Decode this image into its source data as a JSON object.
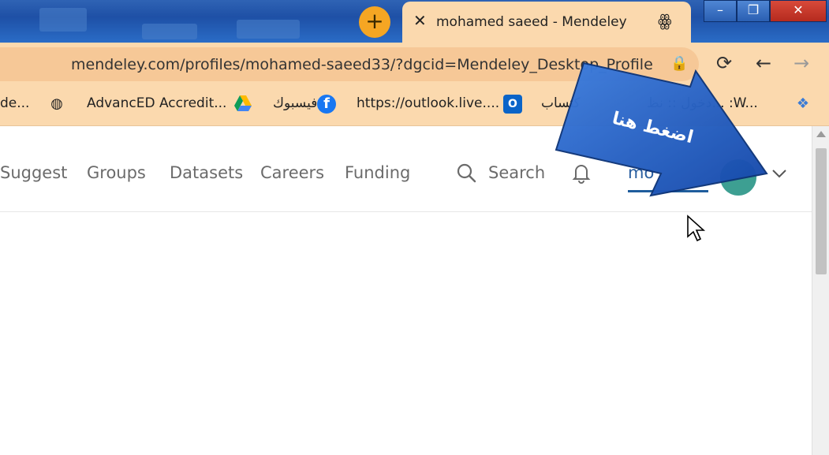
{
  "browser": {
    "tab_title": "mohamed saeed - Mendeley",
    "tab_close": "✕",
    "new_tab": "+",
    "url": "mendeley.com/profiles/mohamed-saeed33/?dgcid=Mendeley_Desktop_Profile",
    "window_controls": [
      "–",
      "❐",
      "✕"
    ]
  },
  "bookmarks": [
    {
      "label": "de...",
      "icon": "none"
    },
    {
      "label": "AdvancED Accredit...",
      "icon": "globe-icon"
    },
    {
      "label": "فيسبوك",
      "icon": "google-drive-icon"
    },
    {
      "label": "https://outlook.live....",
      "icon": "facebook-icon"
    },
    {
      "label": "كتساب",
      "icon": "outlook-icon"
    },
    {
      "label": "دخول :: نظ... :W...",
      "icon": "none"
    }
  ],
  "nav": {
    "items": [
      "Suggest",
      "Groups",
      "Datasets",
      "Careers",
      "Funding"
    ],
    "search_label": "Search",
    "username": "mo"
  },
  "annotation": {
    "text": "اضغط هنا",
    "color": "#1f5ec9"
  },
  "colors": {
    "accent": "#f5a623",
    "chrome": "#fbd9ae",
    "nav_text": "#6b6b6b",
    "link": "#1f5d9c"
  }
}
